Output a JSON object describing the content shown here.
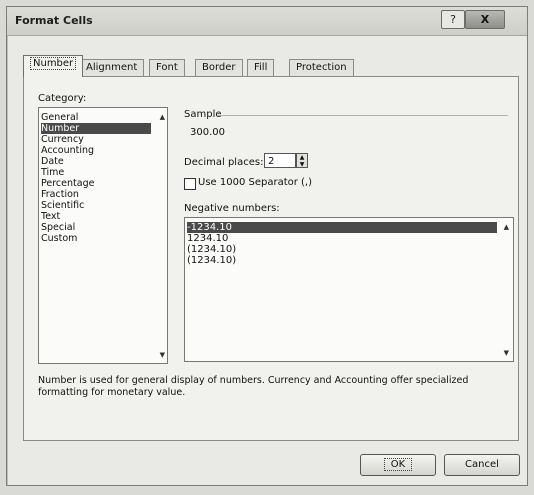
{
  "window": {
    "title": "Format Cells",
    "help_label": "?",
    "close_label": "X"
  },
  "tabs": [
    "Number",
    "Alignment",
    "Font",
    "Border",
    "Fill",
    "Protection"
  ],
  "category": {
    "label": "Category:",
    "items": [
      "General",
      "Number",
      "Currency",
      "Accounting",
      "Date",
      "Time",
      "Percentage",
      "Fraction",
      "Scientific",
      "Text",
      "Special",
      "Custom"
    ],
    "selected": "Number"
  },
  "sample": {
    "label": "Sample",
    "value": "300.00"
  },
  "decimal_places": {
    "label": "Decimal places:",
    "value": "2"
  },
  "separator": {
    "label": "Use 1000 Separator (,)",
    "checked": false
  },
  "negative_numbers": {
    "label": "Negative numbers:",
    "items": [
      "-1234.10",
      "1234.10",
      "(1234.10)",
      "(1234.10)"
    ],
    "selected": "-1234.10"
  },
  "description": "Number is used for general display of numbers.  Currency and Accounting offer specialized formatting for monetary value.",
  "buttons": {
    "ok": "OK",
    "cancel": "Cancel"
  }
}
